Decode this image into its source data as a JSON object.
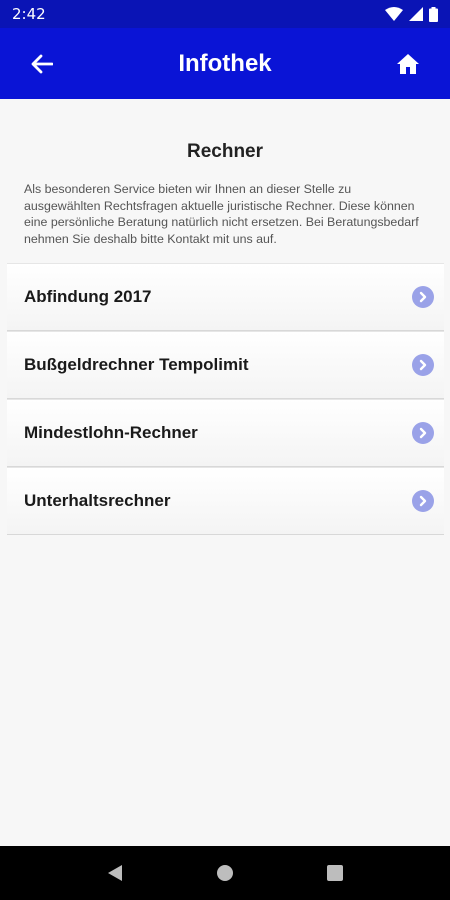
{
  "status_bar": {
    "time": "2:42",
    "icons": [
      "wifi-icon",
      "signal-icon",
      "battery-icon"
    ]
  },
  "app_bar": {
    "title": "Infothek",
    "back_icon": "arrow-left-icon",
    "home_icon": "home-icon",
    "color": "#0a14d6"
  },
  "main": {
    "section_title": "Rechner",
    "intro": "Als besonderen Service bieten wir Ihnen an dieser Stelle zu ausgewählten Rechtsfragen aktuelle juristische Rechner. Diese können eine persönliche Beratung natürlich nicht ersetzen. Bei Beratungsbedarf nehmen Sie deshalb bitte Kontakt mit uns auf.",
    "items": [
      {
        "label": "Abfindung 2017",
        "icon": "chevron-right-circle-icon"
      },
      {
        "label": "Bußgeldrechner Tempolimit",
        "icon": "chevron-right-circle-icon"
      },
      {
        "label": "Mindestlohn-Rechner",
        "icon": "chevron-right-circle-icon"
      },
      {
        "label": "Unterhaltsrechner",
        "icon": "chevron-right-circle-icon"
      }
    ]
  },
  "nav_bar": {
    "buttons": [
      "back-triangle-icon",
      "home-circle-icon",
      "recents-square-icon"
    ]
  }
}
